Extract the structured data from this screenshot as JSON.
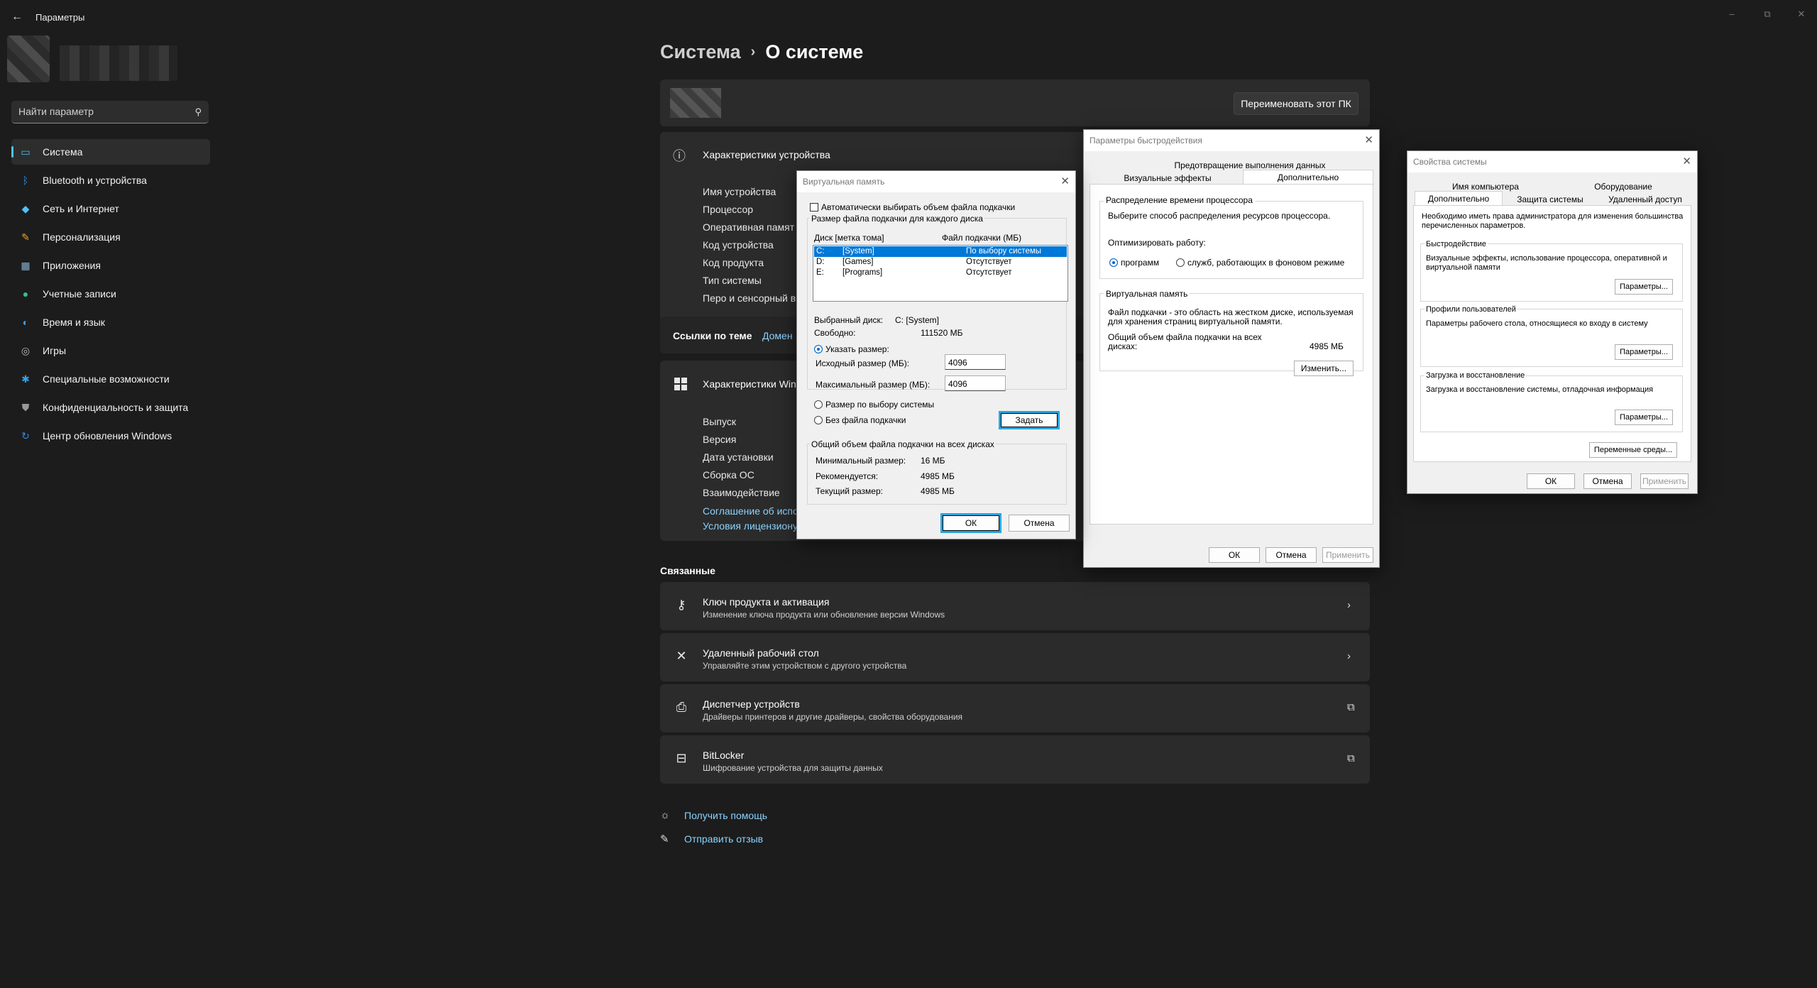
{
  "app": {
    "title": "Параметры"
  },
  "search": {
    "placeholder": "Найти параметр"
  },
  "sidebar": {
    "items": [
      {
        "label": "Система",
        "icon": "display-icon",
        "color": "#4cc2ff",
        "active": true
      },
      {
        "label": "Bluetooth и устройства",
        "icon": "bluetooth-icon",
        "color": "#3b8eea"
      },
      {
        "label": "Сеть и Интернет",
        "icon": "wifi-icon",
        "color": "#4cc2ff"
      },
      {
        "label": "Персонализация",
        "icon": "brush-icon",
        "color": "#f0a030"
      },
      {
        "label": "Приложения",
        "icon": "apps-icon",
        "color": "#8ab4d8"
      },
      {
        "label": "Учетные записи",
        "icon": "person-icon",
        "color": "#35c08a"
      },
      {
        "label": "Время и язык",
        "icon": "globe-clock-icon",
        "color": "#3aa0e8"
      },
      {
        "label": "Игры",
        "icon": "gamepad-icon",
        "color": "#bbbbbb"
      },
      {
        "label": "Специальные возможности",
        "icon": "accessibility-icon",
        "color": "#3aa0e8"
      },
      {
        "label": "Конфиденциальность и защита",
        "icon": "shield-icon",
        "color": "#999999"
      },
      {
        "label": "Центр обновления Windows",
        "icon": "sync-icon",
        "color": "#2f8de4"
      }
    ]
  },
  "main": {
    "breadcrumb_parent": "Система",
    "breadcrumb_sep": "›",
    "breadcrumb_current": "О системе",
    "rename_button": "Переименовать этот ПК",
    "device_specs": {
      "title": "Характеристики устройства",
      "labels": [
        "Имя устройства",
        "Процессор",
        "Оперативная памят",
        "Код устройства",
        "Код продукта",
        "Тип системы",
        "Перо и сенсорный в"
      ]
    },
    "links": {
      "label": "Ссылки по теме",
      "domain": "Домен"
    },
    "windows_specs": {
      "title": "Характеристики Wind",
      "labels": [
        "Выпуск",
        "Версия",
        "Дата установки",
        "Сборка ОС",
        "Взаимодействие"
      ],
      "link1": "Соглашение об испо",
      "link2": "Условия лицензиону"
    },
    "related": {
      "title": "Связанные",
      "items": [
        {
          "title": "Ключ продукта и активация",
          "subtitle": "Изменение ключа продукта или обновление версии Windows",
          "icon": "key-icon",
          "action": "chevron-right-icon"
        },
        {
          "title": "Удаленный рабочий стол",
          "subtitle": "Управляйте этим устройством с другого устройства",
          "icon": "remote-desktop-icon",
          "action": "chevron-right-icon"
        },
        {
          "title": "Диспетчер устройств",
          "subtitle": "Драйверы принтеров и другие драйверы, свойства оборудования",
          "icon": "printer-icon",
          "action": "external-link-icon"
        },
        {
          "title": "BitLocker",
          "subtitle": "Шифрование устройства для защиты данных",
          "icon": "lock-drive-icon",
          "action": "external-link-icon"
        }
      ]
    },
    "help": {
      "get_help": "Получить помощь",
      "feedback": "Отправить отзыв"
    }
  },
  "virtual_memory_dialog": {
    "title": "Виртуальная память",
    "auto_checkbox": "Автоматически выбирать объем файла подкачки",
    "auto_checked": false,
    "group_title": "Размер файла подкачки для каждого диска",
    "col_disk": "Диск [метка тома]",
    "col_size": "Файл подкачки (МБ)",
    "drives": [
      {
        "letter": "C:",
        "label": "[System]",
        "size": "По выбору системы",
        "selected": true
      },
      {
        "letter": "D:",
        "label": "[Games]",
        "size": "Отсутствует",
        "selected": false
      },
      {
        "letter": "E:",
        "label": "[Programs]",
        "size": "Отсутствует",
        "selected": false
      }
    ],
    "selected_disk_label": "Выбранный диск:",
    "selected_disk_value": "C:  [System]",
    "free_label": "Свободно:",
    "free_value": "111520 МБ",
    "custom_size": "Указать размер:",
    "initial_label": "Исходный размер (МБ):",
    "initial_value": "4096",
    "max_label": "Максимальный размер (МБ):",
    "max_value": "4096",
    "system_managed": "Размер по выбору системы",
    "no_paging": "Без файла подкачки",
    "set_button": "Задать",
    "total_group": "Общий объем файла подкачки на всех дисках",
    "min_label": "Минимальный размер:",
    "min_value": "16 МБ",
    "rec_label": "Рекомендуется:",
    "rec_value": "4985 МБ",
    "cur_label": "Текущий размер:",
    "cur_value": "4985 МБ",
    "ok": "ОК",
    "cancel": "Отмена"
  },
  "performance_dialog": {
    "title": "Параметры быстродействия",
    "tab_dep": "Предотвращение выполнения данных",
    "tab_visual": "Визуальные эффекты",
    "tab_advanced": "Дополнительно",
    "cpu_group": "Распределение времени процессора",
    "cpu_desc": "Выберите способ распределения ресурсов процессора.",
    "optimize_label": "Оптимизировать работу:",
    "opt_programs": "программ",
    "opt_services": "служб, работающих в фоновом режиме",
    "vm_group": "Виртуальная память",
    "vm_desc1": "Файл подкачки - это область на жестком диске, используемая",
    "vm_desc2": "для хранения страниц виртуальной памяти.",
    "vm_total1": "Общий объем файла подкачки на всех",
    "vm_total2": "дисках:",
    "vm_total_value": "4985 МБ",
    "change_button": "Изменить...",
    "ok": "ОК",
    "cancel": "Отмена",
    "apply": "Применить"
  },
  "system_properties_dialog": {
    "title": "Свойства системы",
    "tab_computer_name": "Имя компьютера",
    "tab_hardware": "Оборудование",
    "tab_advanced": "Дополнительно",
    "tab_protection": "Защита системы",
    "tab_remote": "Удаленный доступ",
    "admin_note1": "Необходимо иметь права администратора для изменения большинства",
    "admin_note2": "перечисленных параметров.",
    "perf_group": "Быстродействие",
    "perf_desc1": "Визуальные эффекты, использование процессора, оперативной и",
    "perf_desc2": "виртуальной памяти",
    "profiles_group": "Профили пользователей",
    "profiles_desc": "Параметры рабочего стола, относящиеся ко входу в систему",
    "startup_group": "Загрузка и восстановление",
    "startup_desc": "Загрузка и восстановление системы, отладочная информация",
    "params_button": "Параметры...",
    "env_button": "Переменные среды...",
    "ok": "ОК",
    "cancel": "Отмена",
    "apply": "Применить"
  }
}
